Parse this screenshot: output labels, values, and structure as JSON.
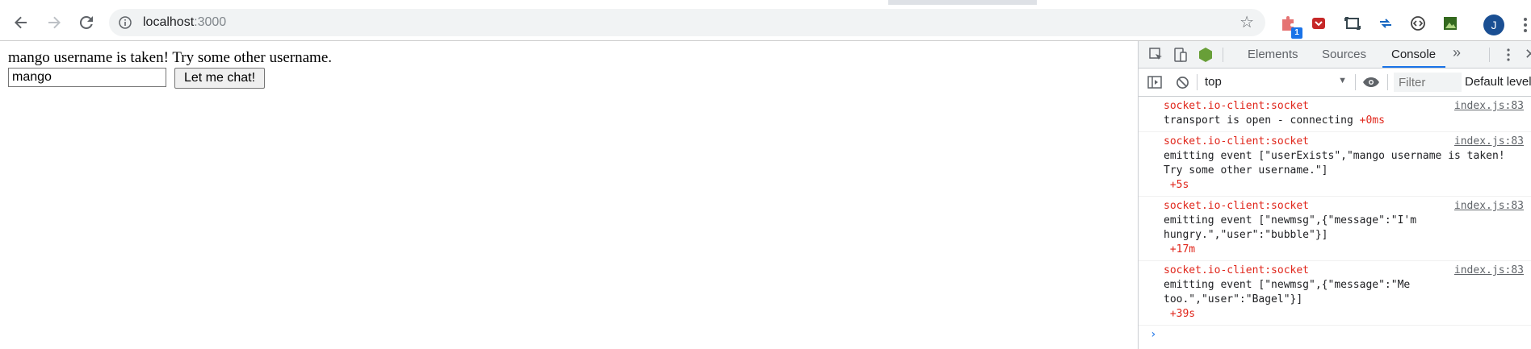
{
  "browser": {
    "url_host": "localhost",
    "url_port": ":3000",
    "extension_badge": "1",
    "profile_initial": "J",
    "icons": {
      "back": "arrow-left-icon",
      "forward": "arrow-right-icon",
      "reload": "reload-icon",
      "site_info": "info-circle-icon",
      "bookmark": "star-icon",
      "menu": "three-dots-vertical-icon"
    }
  },
  "page": {
    "message": "mango username is taken! Try some other username.",
    "username_value": "mango",
    "submit_label": "Let me chat!"
  },
  "devtools": {
    "tabs": [
      {
        "label": "Elements"
      },
      {
        "label": "Sources"
      },
      {
        "label": "Console",
        "active": true
      }
    ],
    "more_tabs": "»",
    "context": "top",
    "filter_placeholder": "Filter",
    "level_label": "Default level:",
    "console": [
      {
        "namespace": "socket.io-client:socket",
        "source": "index.js:83",
        "text": "transport is open - connecting",
        "delta": "+0ms"
      },
      {
        "namespace": "socket.io-client:socket",
        "source": "index.js:83",
        "text": "emitting event [\"userExists\",\"mango username is taken!\nTry some other username.\"]",
        "delta": "+5s"
      },
      {
        "namespace": "socket.io-client:socket",
        "source": "index.js:83",
        "text": "emitting event [\"newmsg\",{\"message\":\"I'm\nhungry.\",\"user\":\"bubble\"}]",
        "delta": "+17m"
      },
      {
        "namespace": "socket.io-client:socket",
        "source": "index.js:83",
        "text": "emitting event [\"newmsg\",{\"message\":\"Me\ntoo.\",\"user\":\"Bagel\"}]",
        "delta": "+39s"
      }
    ],
    "prompt": "›"
  },
  "colors": {
    "accent": "#1a73e8",
    "error_red": "#e0261b",
    "avatar": "#1a4f93"
  }
}
